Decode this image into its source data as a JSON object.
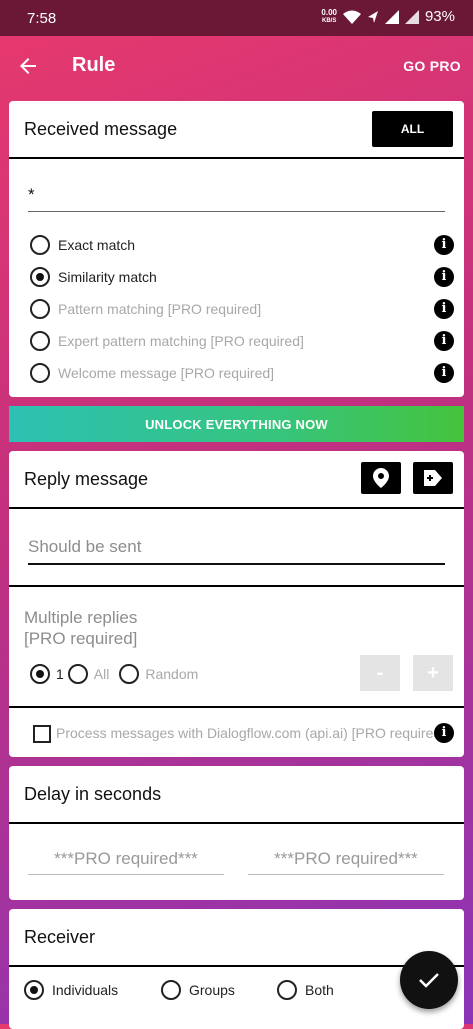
{
  "status_bar": {
    "time": "7:58",
    "net_speed_value": "0.00",
    "net_speed_unit": "KB/S",
    "battery": "93%"
  },
  "app_bar": {
    "title": "Rule",
    "go_pro": "GO PRO"
  },
  "received": {
    "title": "Received message",
    "all_button": "ALL",
    "input_value": "*",
    "options": [
      {
        "label": "Exact match",
        "checked": false,
        "disabled": false
      },
      {
        "label": "Similarity match",
        "checked": true,
        "disabled": false
      },
      {
        "label": "Pattern matching [PRO required]",
        "checked": false,
        "disabled": true
      },
      {
        "label": "Expert pattern matching [PRO required]",
        "checked": false,
        "disabled": true
      },
      {
        "label": "Welcome message [PRO required]",
        "checked": false,
        "disabled": true
      }
    ]
  },
  "unlock_banner": "UNLOCK EVERYTHING NOW",
  "reply": {
    "title": "Reply message",
    "placeholder": "Should be sent",
    "multiple_line1": "Multiple replies",
    "multiple_line2": "[PRO required]",
    "count_options": [
      {
        "label": "1",
        "checked": true
      },
      {
        "label": "All",
        "checked": false
      },
      {
        "label": "Random",
        "checked": false
      }
    ],
    "minus": "-",
    "plus": "+",
    "dialogflow": "Process messages with Dialogflow.com (api.ai) [PRO required]"
  },
  "delay": {
    "title": "Delay in seconds",
    "field1": "***PRO required***",
    "field2": "***PRO required***"
  },
  "receiver": {
    "title": "Receiver",
    "options": [
      {
        "label": "Individuals",
        "checked": true
      },
      {
        "label": "Groups",
        "checked": false
      },
      {
        "label": "Both",
        "checked": false
      }
    ]
  },
  "colors": {
    "status_bar": "#6a1836",
    "gradient_start": "#e8396d",
    "gradient_end": "#8a35b8",
    "unlock_start": "#2cc1b3",
    "unlock_end": "#45c33c"
  }
}
